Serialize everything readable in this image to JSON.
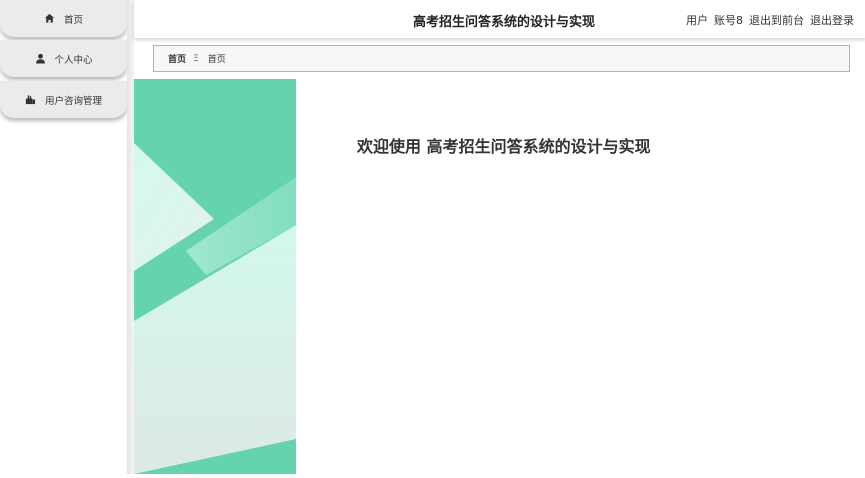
{
  "sidebar": {
    "items": [
      {
        "label": "首页",
        "icon": "home-icon"
      },
      {
        "label": "个人中心",
        "icon": "user-icon"
      },
      {
        "label": "用户咨询管理",
        "icon": "consult-icon"
      }
    ]
  },
  "header": {
    "title": "高考招生问答系统的设计与实现",
    "user_role": "用户",
    "user_account": "账号8",
    "exit_front": "退出到前台",
    "logout": "退出登录"
  },
  "breadcrumb": {
    "home": "首页",
    "separator": "Ξ",
    "current": "首页"
  },
  "main": {
    "welcome": "欢迎使用 高考招生问答系统的设计与实现"
  },
  "colors": {
    "accent": "#6fd5b2",
    "panel_green": "#66d3b0",
    "panel_light": "#d6f8ee"
  }
}
